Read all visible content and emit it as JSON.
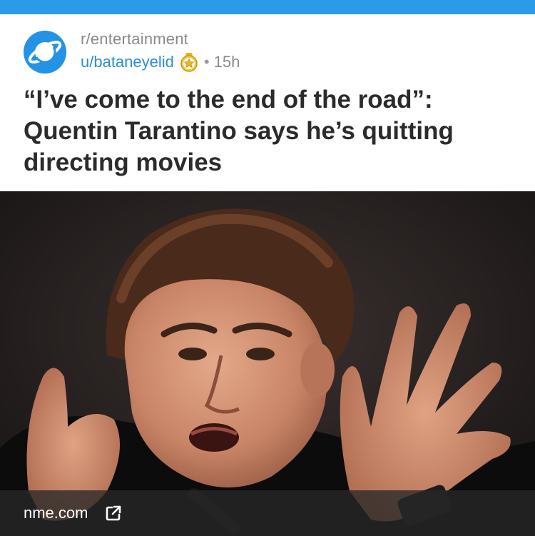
{
  "post": {
    "subreddit": "r/entertainment",
    "username": "u/bataneyelid",
    "separator": "•",
    "time": "15h",
    "title": "“I’ve come to the end of the road”:\nQuentin Tarantino says he’s quitting\ndirecting movies"
  },
  "link": {
    "domain": "nme.com"
  },
  "icons": {
    "avatar": "planet-logo-icon",
    "badge": "star-award-icon",
    "external": "external-link-icon"
  },
  "colors": {
    "top_bar": "#2a9be6",
    "avatar_bg": "#2493e6",
    "username": "#2a8fd6",
    "meta_gray": "#8a8a8a",
    "title": "#2b2b2b"
  }
}
